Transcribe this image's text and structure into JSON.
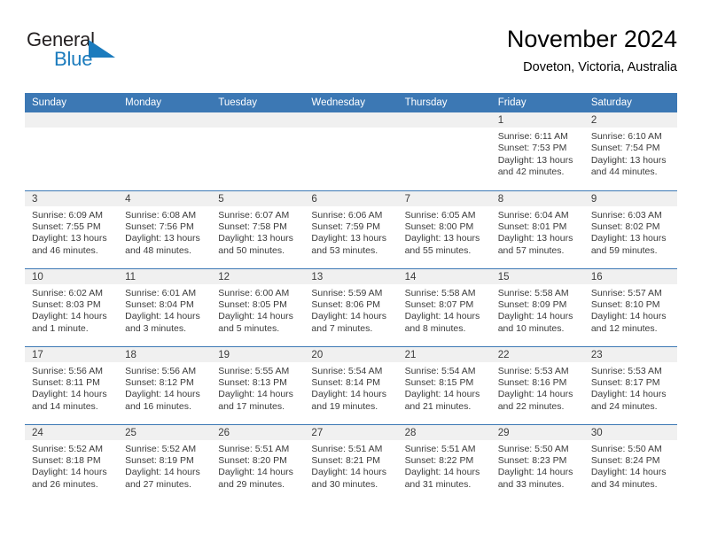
{
  "logo": {
    "word_general": "General",
    "word_blue": "Blue",
    "mark": "triangle-flag-icon",
    "brand_color": "#1b7bbd",
    "text_color": "#231f20"
  },
  "header": {
    "title": "November 2024",
    "location": "Doveton, Victoria, Australia"
  },
  "theme": {
    "header_blue": "#3c78b4",
    "band_gray": "#f0f0f0",
    "text": "#3b3b3b"
  },
  "weekday_headers": [
    "Sunday",
    "Monday",
    "Tuesday",
    "Wednesday",
    "Thursday",
    "Friday",
    "Saturday"
  ],
  "weeks": [
    [
      {
        "day": "",
        "sunrise": "",
        "sunset": "",
        "daylight": ""
      },
      {
        "day": "",
        "sunrise": "",
        "sunset": "",
        "daylight": ""
      },
      {
        "day": "",
        "sunrise": "",
        "sunset": "",
        "daylight": ""
      },
      {
        "day": "",
        "sunrise": "",
        "sunset": "",
        "daylight": ""
      },
      {
        "day": "",
        "sunrise": "",
        "sunset": "",
        "daylight": ""
      },
      {
        "day": "1",
        "sunrise": "Sunrise: 6:11 AM",
        "sunset": "Sunset: 7:53 PM",
        "daylight": "Daylight: 13 hours and 42 minutes."
      },
      {
        "day": "2",
        "sunrise": "Sunrise: 6:10 AM",
        "sunset": "Sunset: 7:54 PM",
        "daylight": "Daylight: 13 hours and 44 minutes."
      }
    ],
    [
      {
        "day": "3",
        "sunrise": "Sunrise: 6:09 AM",
        "sunset": "Sunset: 7:55 PM",
        "daylight": "Daylight: 13 hours and 46 minutes."
      },
      {
        "day": "4",
        "sunrise": "Sunrise: 6:08 AM",
        "sunset": "Sunset: 7:56 PM",
        "daylight": "Daylight: 13 hours and 48 minutes."
      },
      {
        "day": "5",
        "sunrise": "Sunrise: 6:07 AM",
        "sunset": "Sunset: 7:58 PM",
        "daylight": "Daylight: 13 hours and 50 minutes."
      },
      {
        "day": "6",
        "sunrise": "Sunrise: 6:06 AM",
        "sunset": "Sunset: 7:59 PM",
        "daylight": "Daylight: 13 hours and 53 minutes."
      },
      {
        "day": "7",
        "sunrise": "Sunrise: 6:05 AM",
        "sunset": "Sunset: 8:00 PM",
        "daylight": "Daylight: 13 hours and 55 minutes."
      },
      {
        "day": "8",
        "sunrise": "Sunrise: 6:04 AM",
        "sunset": "Sunset: 8:01 PM",
        "daylight": "Daylight: 13 hours and 57 minutes."
      },
      {
        "day": "9",
        "sunrise": "Sunrise: 6:03 AM",
        "sunset": "Sunset: 8:02 PM",
        "daylight": "Daylight: 13 hours and 59 minutes."
      }
    ],
    [
      {
        "day": "10",
        "sunrise": "Sunrise: 6:02 AM",
        "sunset": "Sunset: 8:03 PM",
        "daylight": "Daylight: 14 hours and 1 minute."
      },
      {
        "day": "11",
        "sunrise": "Sunrise: 6:01 AM",
        "sunset": "Sunset: 8:04 PM",
        "daylight": "Daylight: 14 hours and 3 minutes."
      },
      {
        "day": "12",
        "sunrise": "Sunrise: 6:00 AM",
        "sunset": "Sunset: 8:05 PM",
        "daylight": "Daylight: 14 hours and 5 minutes."
      },
      {
        "day": "13",
        "sunrise": "Sunrise: 5:59 AM",
        "sunset": "Sunset: 8:06 PM",
        "daylight": "Daylight: 14 hours and 7 minutes."
      },
      {
        "day": "14",
        "sunrise": "Sunrise: 5:58 AM",
        "sunset": "Sunset: 8:07 PM",
        "daylight": "Daylight: 14 hours and 8 minutes."
      },
      {
        "day": "15",
        "sunrise": "Sunrise: 5:58 AM",
        "sunset": "Sunset: 8:09 PM",
        "daylight": "Daylight: 14 hours and 10 minutes."
      },
      {
        "day": "16",
        "sunrise": "Sunrise: 5:57 AM",
        "sunset": "Sunset: 8:10 PM",
        "daylight": "Daylight: 14 hours and 12 minutes."
      }
    ],
    [
      {
        "day": "17",
        "sunrise": "Sunrise: 5:56 AM",
        "sunset": "Sunset: 8:11 PM",
        "daylight": "Daylight: 14 hours and 14 minutes."
      },
      {
        "day": "18",
        "sunrise": "Sunrise: 5:56 AM",
        "sunset": "Sunset: 8:12 PM",
        "daylight": "Daylight: 14 hours and 16 minutes."
      },
      {
        "day": "19",
        "sunrise": "Sunrise: 5:55 AM",
        "sunset": "Sunset: 8:13 PM",
        "daylight": "Daylight: 14 hours and 17 minutes."
      },
      {
        "day": "20",
        "sunrise": "Sunrise: 5:54 AM",
        "sunset": "Sunset: 8:14 PM",
        "daylight": "Daylight: 14 hours and 19 minutes."
      },
      {
        "day": "21",
        "sunrise": "Sunrise: 5:54 AM",
        "sunset": "Sunset: 8:15 PM",
        "daylight": "Daylight: 14 hours and 21 minutes."
      },
      {
        "day": "22",
        "sunrise": "Sunrise: 5:53 AM",
        "sunset": "Sunset: 8:16 PM",
        "daylight": "Daylight: 14 hours and 22 minutes."
      },
      {
        "day": "23",
        "sunrise": "Sunrise: 5:53 AM",
        "sunset": "Sunset: 8:17 PM",
        "daylight": "Daylight: 14 hours and 24 minutes."
      }
    ],
    [
      {
        "day": "24",
        "sunrise": "Sunrise: 5:52 AM",
        "sunset": "Sunset: 8:18 PM",
        "daylight": "Daylight: 14 hours and 26 minutes."
      },
      {
        "day": "25",
        "sunrise": "Sunrise: 5:52 AM",
        "sunset": "Sunset: 8:19 PM",
        "daylight": "Daylight: 14 hours and 27 minutes."
      },
      {
        "day": "26",
        "sunrise": "Sunrise: 5:51 AM",
        "sunset": "Sunset: 8:20 PM",
        "daylight": "Daylight: 14 hours and 29 minutes."
      },
      {
        "day": "27",
        "sunrise": "Sunrise: 5:51 AM",
        "sunset": "Sunset: 8:21 PM",
        "daylight": "Daylight: 14 hours and 30 minutes."
      },
      {
        "day": "28",
        "sunrise": "Sunrise: 5:51 AM",
        "sunset": "Sunset: 8:22 PM",
        "daylight": "Daylight: 14 hours and 31 minutes."
      },
      {
        "day": "29",
        "sunrise": "Sunrise: 5:50 AM",
        "sunset": "Sunset: 8:23 PM",
        "daylight": "Daylight: 14 hours and 33 minutes."
      },
      {
        "day": "30",
        "sunrise": "Sunrise: 5:50 AM",
        "sunset": "Sunset: 8:24 PM",
        "daylight": "Daylight: 14 hours and 34 minutes."
      }
    ]
  ]
}
